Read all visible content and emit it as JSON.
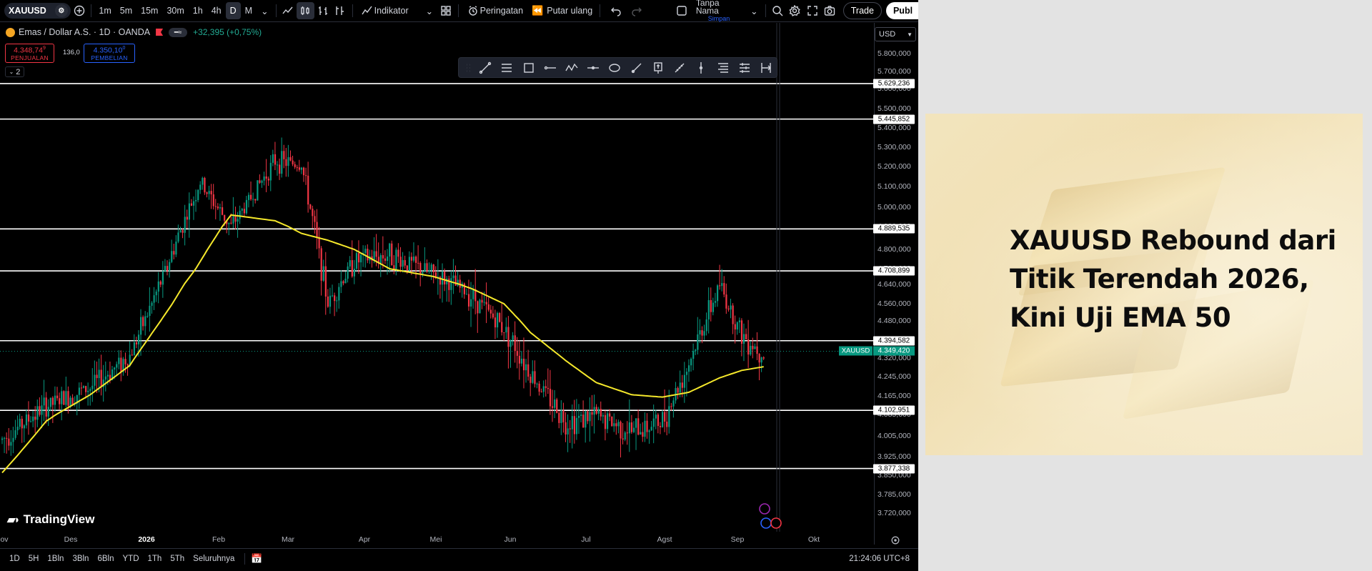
{
  "toolbar": {
    "symbol": "XAUUSD",
    "intervals": [
      "1m",
      "5m",
      "15m",
      "30m",
      "1h",
      "4h",
      "D",
      "M"
    ],
    "active_interval": "D",
    "indicators_label": "Indikator",
    "alerts_label": "Peringatan",
    "replay_label": "Putar ulang",
    "layout_name": "Tanpa Nama",
    "layout_status": "Simpan",
    "trade_label": "Trade",
    "publish_label": "Publ"
  },
  "legend": {
    "instrument": "Emas / Dollar A.S. · 1D · OANDA",
    "change": "+32,395 (+0,75%)",
    "sell_price": "4.348,74",
    "sell_price_sup": "9",
    "sell_label": "PENJUALAN",
    "spread": "136,0",
    "buy_price": "4.350,10",
    "buy_price_sup": "0",
    "buy_label": "PEMBELIAN",
    "collapse_count": "2"
  },
  "currency": "USD",
  "price_axis": {
    "ticks": [
      "5.800,000",
      "5.700,000",
      "5.600,000",
      "5.500,000",
      "5.400,000",
      "5.300,000",
      "5.200,000",
      "5.100,000",
      "5.000,000",
      "4.900,000",
      "4.800,000",
      "4.720,000",
      "4.640,000",
      "4.560,000",
      "4.480,000",
      "4.400,000",
      "4.320,000",
      "4.245,000",
      "4.165,000",
      "4.085,000",
      "4.005,000",
      "3.925,000",
      "3.850,000",
      "3.785,000",
      "3.720,000"
    ],
    "tick_values": [
      5800,
      5700,
      5600,
      5500,
      5400,
      5300,
      5200,
      5100,
      5000,
      4900,
      4800,
      4720,
      4640,
      4560,
      4480,
      4400,
      4320,
      4245,
      4165,
      4085,
      4005,
      3925,
      3850,
      3785,
      3720
    ],
    "horizontal_levels": [
      {
        "value": 5629.236,
        "label": "5.629,236"
      },
      {
        "value": 5445.852,
        "label": "5.445,852"
      },
      {
        "value": 4889.535,
        "label": "4.889,535"
      },
      {
        "value": 4708.899,
        "label": "4.708,899"
      },
      {
        "value": 4394.582,
        "label": "4.394,582"
      },
      {
        "value": 4102.951,
        "label": "4.102,951"
      },
      {
        "value": 3877.338,
        "label": "3.877,338"
      }
    ],
    "last_symbol": "XAUUSD",
    "last_price": "4.349,420"
  },
  "time_axis": {
    "labels": [
      "ov",
      "Des",
      "2026",
      "Feb",
      "Mar",
      "Apr",
      "Mei",
      "Jun",
      "Jul",
      "Agst",
      "Sep",
      "Okt"
    ],
    "bold_label": "2026"
  },
  "branding": "TradingView",
  "bottom_bar": {
    "ranges": [
      "1D",
      "5H",
      "1Bln",
      "3Bln",
      "6Bln",
      "YTD",
      "1Th",
      "5Th",
      "Seluruhnya"
    ],
    "clock": "21:24:06 UTC+8"
  },
  "colors": {
    "up": "#089981",
    "down": "#f23645",
    "ema": "#f5e82b",
    "level_line": "#ffffff"
  },
  "promo": {
    "title_lines": [
      "XAUUSD Rebound dari",
      "Titik Terendah 2026,",
      "Kini Uji EMA 50"
    ]
  },
  "chart_data": {
    "type": "candlestick",
    "title": "Emas / Dollar A.S. · 1D · OANDA",
    "ylim": [
      3690,
      5840
    ],
    "series": [
      {
        "name": "XAUUSD",
        "kind": "candlestick",
        "anchor_closes": [
          [
            0,
            3990
          ],
          [
            20,
            4120
          ],
          [
            40,
            4200
          ],
          [
            58,
            4330
          ],
          [
            72,
            4650
          ],
          [
            90,
            5120
          ],
          [
            104,
            4900
          ],
          [
            124,
            5230
          ],
          [
            136,
            5210
          ],
          [
            148,
            4560
          ],
          [
            160,
            4750
          ],
          [
            176,
            4780
          ],
          [
            196,
            4690
          ],
          [
            214,
            4590
          ],
          [
            228,
            4450
          ],
          [
            240,
            4260
          ],
          [
            256,
            4060
          ],
          [
            270,
            4080
          ],
          [
            286,
            4020
          ],
          [
            300,
            4060
          ],
          [
            312,
            4300
          ],
          [
            326,
            4640
          ],
          [
            336,
            4420
          ],
          [
            346,
            4340
          ]
        ]
      },
      {
        "name": "EMA 50",
        "kind": "line",
        "anchor_values": [
          [
            0,
            3860
          ],
          [
            20,
            4060
          ],
          [
            40,
            4170
          ],
          [
            58,
            4290
          ],
          [
            72,
            4480
          ],
          [
            90,
            4750
          ],
          [
            104,
            4960
          ],
          [
            124,
            4930
          ],
          [
            136,
            4870
          ],
          [
            148,
            4840
          ],
          [
            160,
            4800
          ],
          [
            176,
            4720
          ],
          [
            196,
            4680
          ],
          [
            214,
            4620
          ],
          [
            228,
            4560
          ],
          [
            240,
            4430
          ],
          [
            256,
            4310
          ],
          [
            270,
            4220
          ],
          [
            286,
            4170
          ],
          [
            300,
            4160
          ],
          [
            312,
            4180
          ],
          [
            326,
            4240
          ],
          [
            336,
            4270
          ],
          [
            346,
            4285
          ]
        ]
      }
    ]
  }
}
